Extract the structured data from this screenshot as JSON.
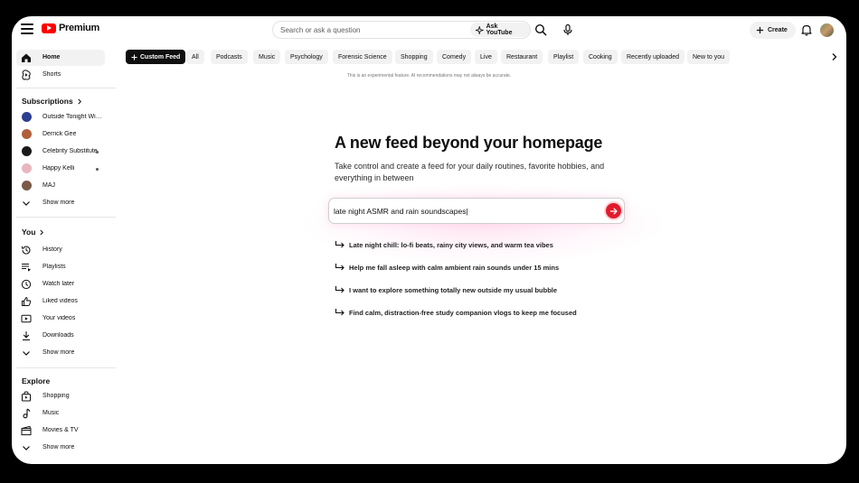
{
  "topbar": {
    "logo_text": "Premium",
    "search_placeholder": "Search or ask a question",
    "ask_label": "Ask YouTube",
    "create_label": "Create"
  },
  "sidebar": {
    "main": [
      {
        "label": "Home",
        "icon": "home-icon"
      },
      {
        "label": "Shorts",
        "icon": "shorts-icon"
      }
    ],
    "subscriptions_heading": "Subscriptions",
    "subscriptions": [
      {
        "label": "Outside Tonight With...",
        "color": "#2c3e8f",
        "dot": false
      },
      {
        "label": "Derrick Gee",
        "color": "#b0603a",
        "dot": false
      },
      {
        "label": "Celebrity Substitute",
        "color": "#1a1a1a",
        "dot": true
      },
      {
        "label": "Happy Kelli",
        "color": "#e8b6c0",
        "dot": true
      },
      {
        "label": "MAJ",
        "color": "#7b5a4a",
        "dot": false
      }
    ],
    "show_more": "Show more",
    "you_heading": "You",
    "you_items": [
      {
        "label": "History",
        "icon": "history-icon"
      },
      {
        "label": "Playlists",
        "icon": "playlists-icon"
      },
      {
        "label": "Watch later",
        "icon": "watch-later-icon"
      },
      {
        "label": "Liked videos",
        "icon": "thumb-up-icon"
      },
      {
        "label": "Your videos",
        "icon": "your-videos-icon"
      },
      {
        "label": "Downloads",
        "icon": "download-icon"
      }
    ],
    "explore_heading": "Explore",
    "explore_items": [
      {
        "label": "Shopping",
        "icon": "shopping-bag-icon"
      },
      {
        "label": "Music",
        "icon": "music-note-icon"
      },
      {
        "label": "Movies & TV",
        "icon": "clapperboard-icon"
      }
    ]
  },
  "chips": [
    "Custom Feed",
    "All",
    "Podcasts",
    "Music",
    "Psychology",
    "Forensic Science",
    "Shopping",
    "Comedy",
    "Live",
    "Restaurant",
    "Playlist",
    "Cooking",
    "Recently uploaded",
    "New to you"
  ],
  "disclaimer": "This is an experimental feature. AI recommendations may not always be accurate.",
  "main": {
    "headline": "A new feed beyond your homepage",
    "subcopy": "Take control and create a feed for your daily routines, favorite hobbies, and everything in between",
    "prompt_value": "late night ASMR and rain soundscapes|",
    "suggestions": [
      "Late night chill: lo-fi beats, rainy city views, and warm tea vibes",
      "Help me fall asleep with calm ambient rain sounds under 15 mins",
      "I want to explore something totally new outside my usual bubble",
      "Find calm, distraction-free study companion vlogs to keep me focused"
    ]
  },
  "colors": {
    "accent": "#ff0000",
    "send_button": "#e11a2c",
    "chip_bg": "#f2f2f2",
    "active_chip_bg": "#0f0f0f"
  }
}
